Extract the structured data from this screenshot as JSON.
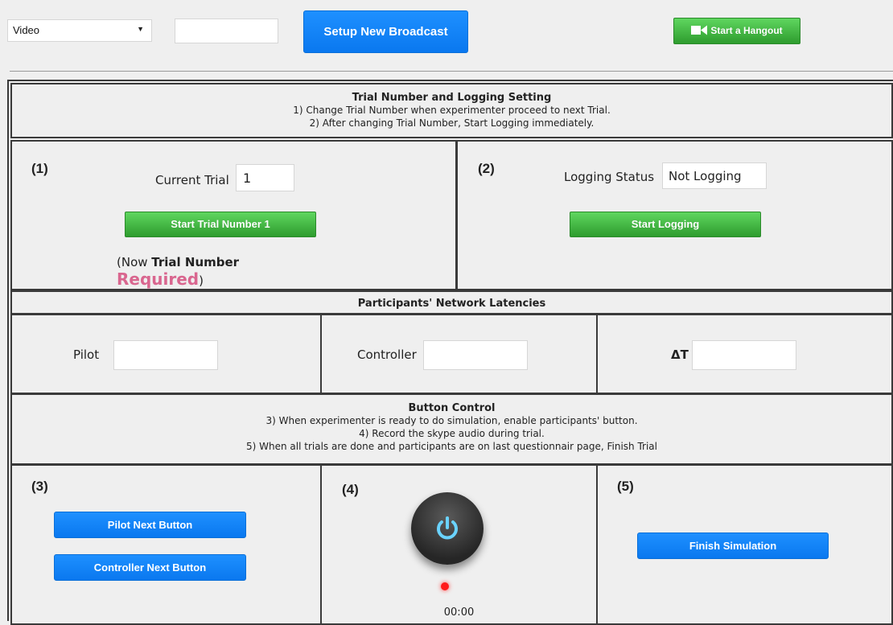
{
  "toolbar": {
    "source_select": "Video",
    "text_value": "",
    "setup_button": "Setup New Broadcast",
    "hangout_button": "Start a Hangout"
  },
  "trial_section": {
    "title": "Trial Number and Logging Setting",
    "line1": "1) Change Trial Number when experimenter proceed to next Trial.",
    "line2": "2) After changing Trial Number, Start Logging immediately."
  },
  "trial_cell": {
    "index": "(1)",
    "current_trial_label": "Current Trial",
    "current_trial_value": "1",
    "start_trial_button": "Start Trial Number 1",
    "status_prefix": "(Now ",
    "status_bold": "Trial Number",
    "status_required": "Required",
    "status_suffix": ")"
  },
  "logging_cell": {
    "index": "(2)",
    "status_label": "Logging Status",
    "status_value": "Not Logging",
    "start_button": "Start Logging"
  },
  "latency_section": {
    "title": "Participants' Network Latencies",
    "pilot_label": "Pilot",
    "pilot_value": "",
    "controller_label": "Controller",
    "controller_value": "",
    "delta_label": "ΔT",
    "delta_value": ""
  },
  "button_section": {
    "title": "Button Control",
    "line3": "3) When experimenter is ready to do simulation, enable participants' button.",
    "line4": "4) Record the skype audio during trial.",
    "line5": "5) When all trials are done and participants are on last questionnair page, Finish Trial"
  },
  "control_cells": {
    "index3": "(3)",
    "pilot_next": "Pilot Next Button",
    "controller_next": "Controller Next Button",
    "index4": "(4)",
    "timer": "00:00",
    "index5": "(5)",
    "finish": "Finish Simulation"
  },
  "colors": {
    "blue": "#1e90ff",
    "green": "#3cb83c",
    "required_pink": "#d9668f",
    "record_dot": "#ff1a1a"
  }
}
